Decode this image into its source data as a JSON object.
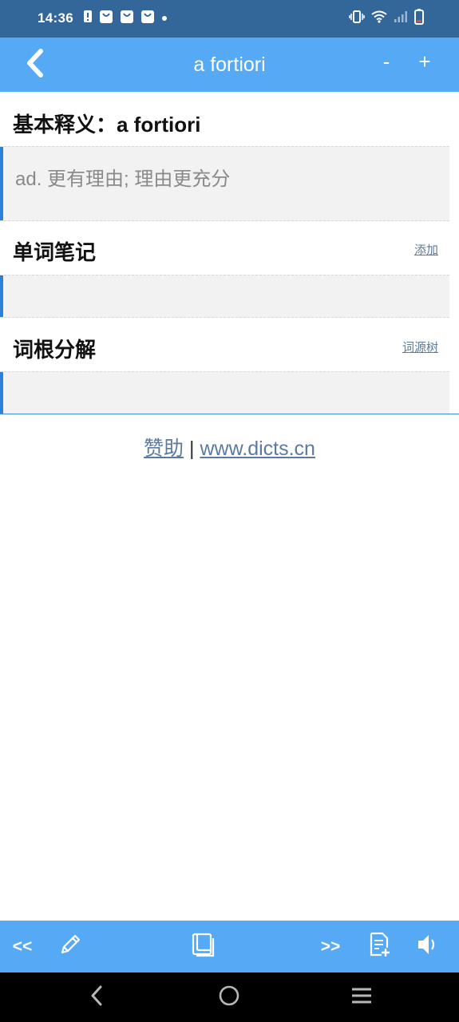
{
  "status_bar": {
    "time": "14:36"
  },
  "header": {
    "title": "a fortiori",
    "zoom_out_label": "-",
    "zoom_in_label": "+"
  },
  "definition": {
    "heading": "基本释义：a fortiori",
    "text": "ad. 更有理由; 理由更充分"
  },
  "notes": {
    "heading": "单词笔记",
    "link": "添加"
  },
  "roots": {
    "heading": "词根分解",
    "link": "词源树"
  },
  "footer": {
    "sponsor_link": "赞助",
    "separator": "|",
    "site_link": "www.dicts.cn"
  },
  "toolbar": {
    "prev_label": "<<",
    "next_label": ">>",
    "icons": [
      "pencil-icon",
      "book-icon",
      "add-note-icon",
      "speaker-icon"
    ]
  },
  "colors": {
    "status_bar": "#336699",
    "app_bar": "#55a9f5",
    "accent": "#2e7fd8",
    "link": "#5c7aa0"
  }
}
